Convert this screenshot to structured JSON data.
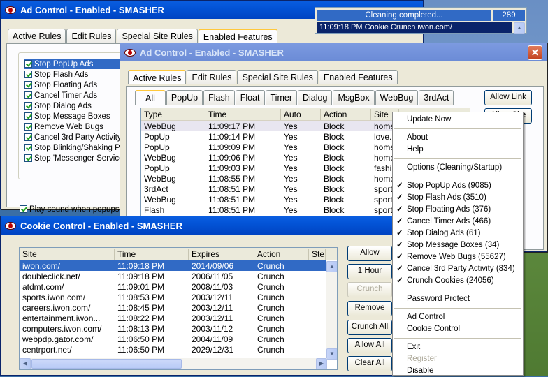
{
  "bg_window": {
    "title": "Ad Control - Enabled - SMASHER",
    "tabs": [
      "Active Rules",
      "Edit Rules",
      "Special Site Rules",
      "Enabled Features"
    ],
    "features": [
      "Stop PopUp Ads",
      "Stop Flash Ads",
      "Stop Floating Ads",
      "Cancel Timer Ads",
      "Stop Dialog Ads",
      "Stop Message Boxes",
      "Remove Web Bugs",
      "Cancel 3rd Party Activity",
      "Stop Blinking/Shaking Pict",
      "Stop 'Messenger Service'"
    ],
    "sound": "Play sound when popups a"
  },
  "notify": {
    "status": "Cleaning completed...",
    "count": "289",
    "log": "11:09:18 PM Cookie Crunch  iwon.com/"
  },
  "ad_window": {
    "title": "Ad Control - Enabled - SMASHER",
    "tabs": [
      "Active Rules",
      "Edit Rules",
      "Special Site Rules",
      "Enabled Features"
    ],
    "subtabs": [
      "All",
      "PopUp",
      "Flash",
      "Float",
      "Timer",
      "Dialog",
      "MsgBox",
      "WebBug",
      "3rdAct"
    ],
    "allow_link": "Allow Link",
    "allow_site": "Allow Site",
    "columns": [
      "Type",
      "Time",
      "Auto",
      "Action",
      "Site"
    ],
    "rows": [
      [
        "WebBug",
        "11:09:17 PM",
        "Yes",
        "Block",
        "home"
      ],
      [
        "PopUp",
        "11:09:14 PM",
        "Yes",
        "Block",
        "love."
      ],
      [
        "PopUp",
        "11:09:09 PM",
        "Yes",
        "Block",
        "home"
      ],
      [
        "WebBug",
        "11:09:06 PM",
        "Yes",
        "Block",
        "home"
      ],
      [
        "PopUp",
        "11:09:03 PM",
        "Yes",
        "Block",
        "fashi"
      ],
      [
        "WebBug",
        "11:08:55 PM",
        "Yes",
        "Block",
        "home"
      ],
      [
        "3rdAct",
        "11:08:51 PM",
        "Yes",
        "Block",
        "sport"
      ],
      [
        "WebBug",
        "11:08:51 PM",
        "Yes",
        "Block",
        "sport"
      ],
      [
        "Flash",
        "11:08:51 PM",
        "Yes",
        "Block",
        "sport"
      ]
    ]
  },
  "cookie_window": {
    "title": "Cookie Control - Enabled - SMASHER",
    "columns": [
      "Site",
      "Time",
      "Expires",
      "Action",
      "Ste"
    ],
    "rows": [
      [
        "iwon.com/",
        "11:09:18 PM",
        "2014/09/06",
        "Crunch"
      ],
      [
        "doubleclick.net/",
        "11:09:18 PM",
        "2006/11/05",
        "Crunch"
      ],
      [
        "atdmt.com/",
        "11:09:01 PM",
        "2008/11/03",
        "Crunch"
      ],
      [
        "sports.iwon.com/",
        "11:08:53 PM",
        "2003/12/11",
        "Crunch"
      ],
      [
        "careers.iwon.com/",
        "11:08:45 PM",
        "2003/12/11",
        "Crunch"
      ],
      [
        "entertainment.iwon...",
        "11:08:22 PM",
        "2003/12/11",
        "Crunch"
      ],
      [
        "computers.iwon.com/",
        "11:08:13 PM",
        "2003/11/12",
        "Crunch"
      ],
      [
        "webpdp.gator.com/",
        "11:06:50 PM",
        "2004/11/09",
        "Crunch"
      ],
      [
        "centrport.net/",
        "11:06:50 PM",
        "2029/12/31",
        "Crunch"
      ]
    ],
    "buttons": {
      "allow": "Allow",
      "hour": "1 Hour",
      "crunch": "Crunch",
      "remove": "Remove",
      "crunch_all": "Crunch All",
      "allow_all": "Allow All",
      "clear_all": "Clear All"
    }
  },
  "menu": {
    "update": "Update Now",
    "about": "About",
    "help": "Help",
    "options": "Options (Cleaning/Startup)",
    "checked_items": [
      "Stop PopUp Ads (9085)",
      "Stop Flash Ads (3510)",
      "Stop Floating Ads (376)",
      "Cancel Timer Ads (466)",
      "Stop Dialog Ads (61)",
      "Stop Message Boxes (34)",
      "Remove Web Bugs (55627)",
      "Cancel 3rd Party Activity (834)",
      "Crunch Cookies (24056)"
    ],
    "password": "Password Protect",
    "ad_control": "Ad Control",
    "cookie_control": "Cookie Control",
    "exit": "Exit",
    "register": "Register",
    "disable": "Disable"
  }
}
